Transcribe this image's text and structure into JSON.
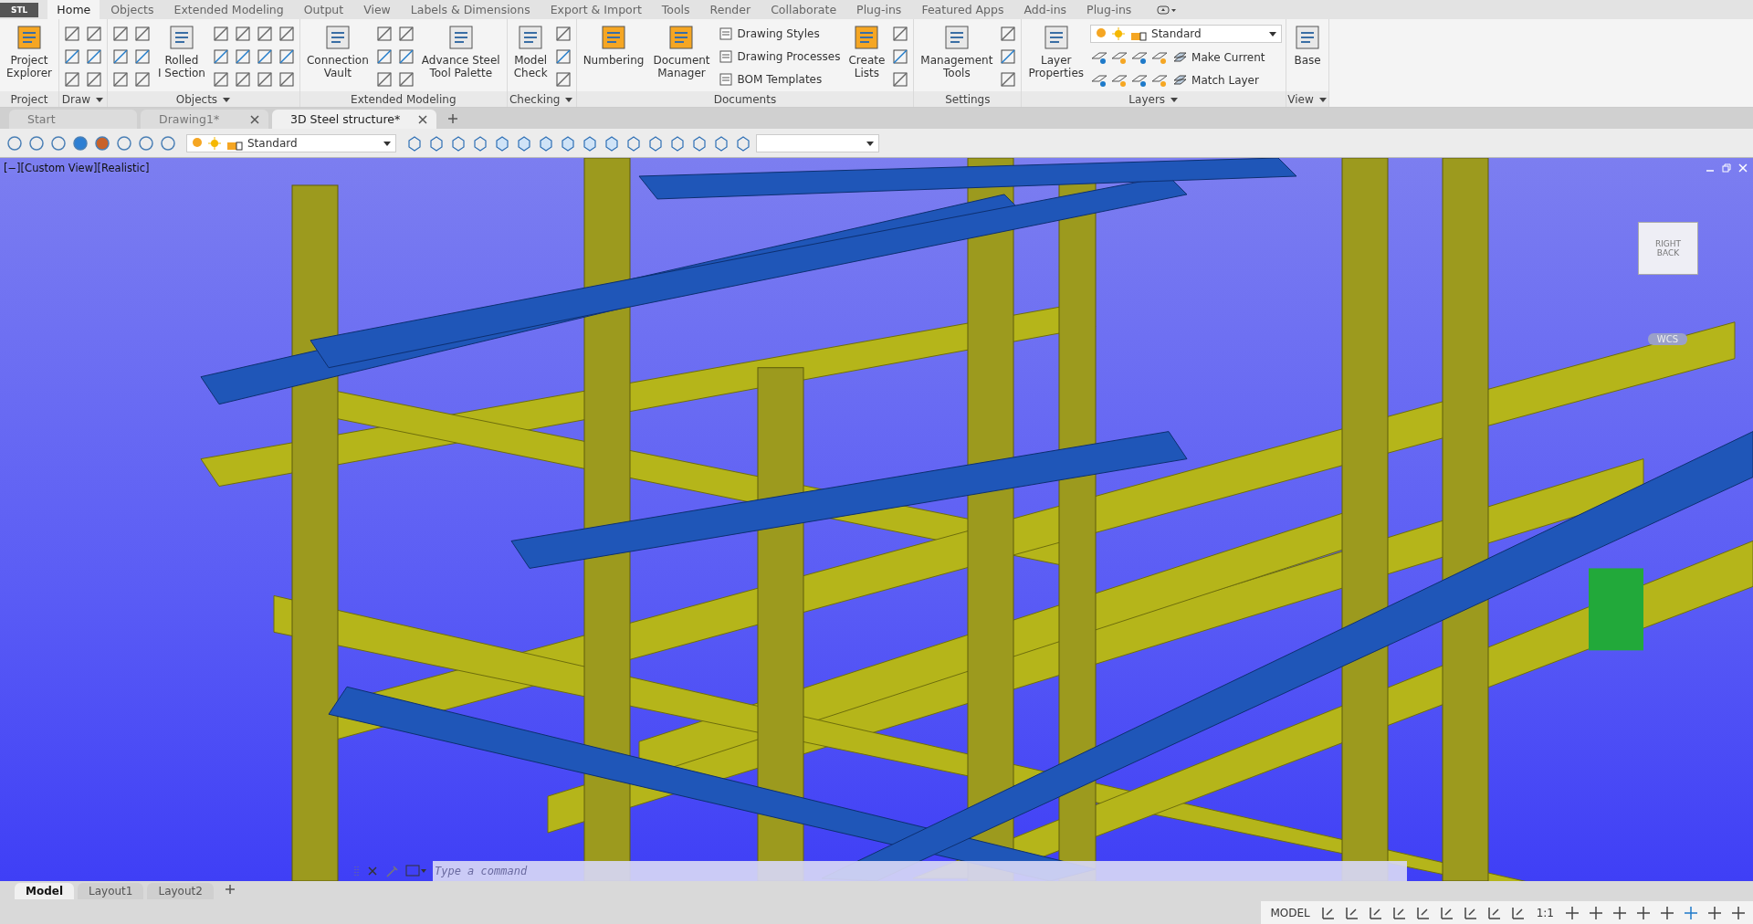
{
  "app_button": "STL",
  "ribbon_tabs": [
    {
      "label": "Home",
      "selected": true
    },
    {
      "label": "Objects",
      "selected": false
    },
    {
      "label": "Extended Modeling",
      "selected": false
    },
    {
      "label": "Output",
      "selected": false
    },
    {
      "label": "View",
      "selected": false
    },
    {
      "label": "Labels & Dimensions",
      "selected": false
    },
    {
      "label": "Export & Import",
      "selected": false
    },
    {
      "label": "Tools",
      "selected": false
    },
    {
      "label": "Render",
      "selected": false
    },
    {
      "label": "Collaborate",
      "selected": false
    },
    {
      "label": "Plug-ins",
      "selected": false
    },
    {
      "label": "Featured Apps",
      "selected": false
    },
    {
      "label": "Add-ins",
      "selected": false
    },
    {
      "label": "Plug-ins",
      "selected": false
    }
  ],
  "panels": [
    {
      "title": "Project",
      "dropdown": false,
      "items": [
        {
          "kind": "large",
          "lines": [
            "Project",
            "Explorer"
          ]
        }
      ]
    },
    {
      "title": "Draw",
      "dropdown": true,
      "items": [
        {
          "kind": "icons"
        },
        {
          "kind": "icons"
        }
      ]
    },
    {
      "title": "Objects",
      "dropdown": true,
      "items": [
        {
          "kind": "icons"
        },
        {
          "kind": "icons"
        },
        {
          "kind": "large",
          "lines": [
            "Rolled",
            "I Section"
          ]
        },
        {
          "kind": "icons"
        },
        {
          "kind": "icons"
        },
        {
          "kind": "icons"
        },
        {
          "kind": "icons"
        }
      ]
    },
    {
      "title": "Extended Modeling",
      "dropdown": false,
      "items": [
        {
          "kind": "large",
          "lines": [
            "Connection",
            "Vault"
          ]
        },
        {
          "kind": "icons"
        },
        {
          "kind": "icons"
        },
        {
          "kind": "large",
          "lines": [
            "Advance Steel",
            "Tool Palette"
          ]
        }
      ]
    },
    {
      "title": "Checking",
      "dropdown": true,
      "items": [
        {
          "kind": "large",
          "lines": [
            "Model",
            "Check"
          ]
        },
        {
          "kind": "icons"
        }
      ]
    },
    {
      "title": "Documents",
      "dropdown": false,
      "items": [
        {
          "kind": "large",
          "lines": [
            "Numbering"
          ]
        },
        {
          "kind": "large",
          "lines": [
            "Document",
            "Manager"
          ]
        },
        {
          "kind": "list",
          "labels": [
            "Drawing Styles",
            "Drawing Processes",
            "BOM Templates"
          ]
        },
        {
          "kind": "large",
          "lines": [
            "Create",
            "Lists"
          ]
        },
        {
          "kind": "icons"
        }
      ]
    },
    {
      "title": "Settings",
      "dropdown": false,
      "items": [
        {
          "kind": "large",
          "lines": [
            "Management",
            "Tools"
          ]
        },
        {
          "kind": "icons"
        }
      ]
    },
    {
      "title": "Layers",
      "dropdown": true,
      "items": [
        {
          "kind": "large",
          "lines": [
            "Layer",
            "Properties"
          ]
        },
        {
          "kind": "layers",
          "combo": "Standard",
          "labels": [
            "Make Current",
            "Match Layer"
          ]
        }
      ]
    },
    {
      "title": "View",
      "dropdown": true,
      "items": [
        {
          "kind": "large",
          "lines": [
            "Base"
          ]
        }
      ]
    }
  ],
  "doc_tabs": [
    {
      "label": "Start",
      "selected": false,
      "closable": false
    },
    {
      "label": "Drawing1*",
      "selected": false,
      "closable": true
    },
    {
      "label": "3D Steel structure*",
      "selected": true,
      "closable": true
    }
  ],
  "toolbar": {
    "layer": "Standard"
  },
  "viewport": {
    "label": "[−][Custom View][Realistic]",
    "viewcube": [
      "RIGHT",
      "BACK"
    ],
    "ucs": "WCS"
  },
  "command_line": {
    "placeholder": "Type a command"
  },
  "layout_tabs": [
    {
      "label": "Model",
      "selected": true
    },
    {
      "label": "Layout1",
      "selected": false
    },
    {
      "label": "Layout2",
      "selected": false
    }
  ],
  "status_bar": {
    "mode": "MODEL",
    "scale": "1:1"
  }
}
